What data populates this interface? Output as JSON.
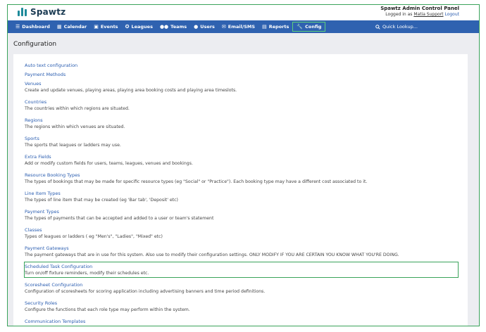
{
  "header": {
    "logo_text": "Spawtz",
    "panel_title": "Spawtz Admin Control Panel",
    "logged_in_prefix": "Logged in as",
    "user": "Matia Support",
    "logout": "Logout"
  },
  "nav": {
    "items": [
      {
        "label": "Dashboard",
        "icon": "stack-icon"
      },
      {
        "label": "Calendar",
        "icon": "calendar-icon"
      },
      {
        "label": "Events",
        "icon": "calendar-check-icon"
      },
      {
        "label": "Leagues",
        "icon": "trophy-icon"
      },
      {
        "label": "Teams",
        "icon": "users-icon"
      },
      {
        "label": "Users",
        "icon": "user-icon"
      },
      {
        "label": "Email/SMS",
        "icon": "envelope-icon"
      },
      {
        "label": "Reports",
        "icon": "chart-icon"
      },
      {
        "label": "Config",
        "icon": "wrench-icon"
      }
    ],
    "active": "Config",
    "quick_lookup": "Quick Lookup..."
  },
  "page": {
    "title": "Configuration"
  },
  "config_items": [
    {
      "title": "Auto text configuration",
      "desc": ""
    },
    {
      "title": "Payment Methods",
      "desc": ""
    },
    {
      "title": "Venues",
      "desc": "Create and update venues, playing areas, playing area booking costs and playing area timeslots."
    },
    {
      "title": "Countries",
      "desc": "The countries within which regions are situated."
    },
    {
      "title": "Regions",
      "desc": "The regions within which venues are situated."
    },
    {
      "title": "Sports",
      "desc": "The sports that leagues or ladders may use."
    },
    {
      "title": "Extra Fields",
      "desc": "Add or modify custom fields for users, teams, leagues, venues and bookings."
    },
    {
      "title": "Resource Booking Types",
      "desc": "The types of bookings that may be made for specific resource types (eg \"Social\" or \"Practice\"). Each booking type may have a different cost associated to it."
    },
    {
      "title": "Line Item Types",
      "desc": "The types of line item that may be created (eg 'Bar tab', 'Deposit' etc)"
    },
    {
      "title": "Payment Types",
      "desc": "The types of payments that can be accepted and added to a user or team's statement"
    },
    {
      "title": "Classes",
      "desc": "Types of leagues or ladders ( eg \"Men's\", \"Ladies\", \"Mixed\" etc)"
    },
    {
      "title": "Payment Gateways",
      "desc": "The payment gateways that are in use for this system. Also use to modify their configuration settings. ONLY MODIFY IF YOU ARE CERTAIN YOU KNOW WHAT YOU'RE DOING."
    },
    {
      "title": "Scheduled Task Configuration",
      "desc": "Turn on/off fixture reminders, modify their schedules etc."
    },
    {
      "title": "Scoresheet Configuration",
      "desc": "Configuration of scoresheets for scoring application including advertising banners and time period definitions."
    },
    {
      "title": "Security Roles",
      "desc": "Configure the functions that each role type may perform within the system."
    },
    {
      "title": "Communication Templates",
      "desc": ""
    }
  ],
  "highlighted_item": "Scheduled Task Configuration"
}
